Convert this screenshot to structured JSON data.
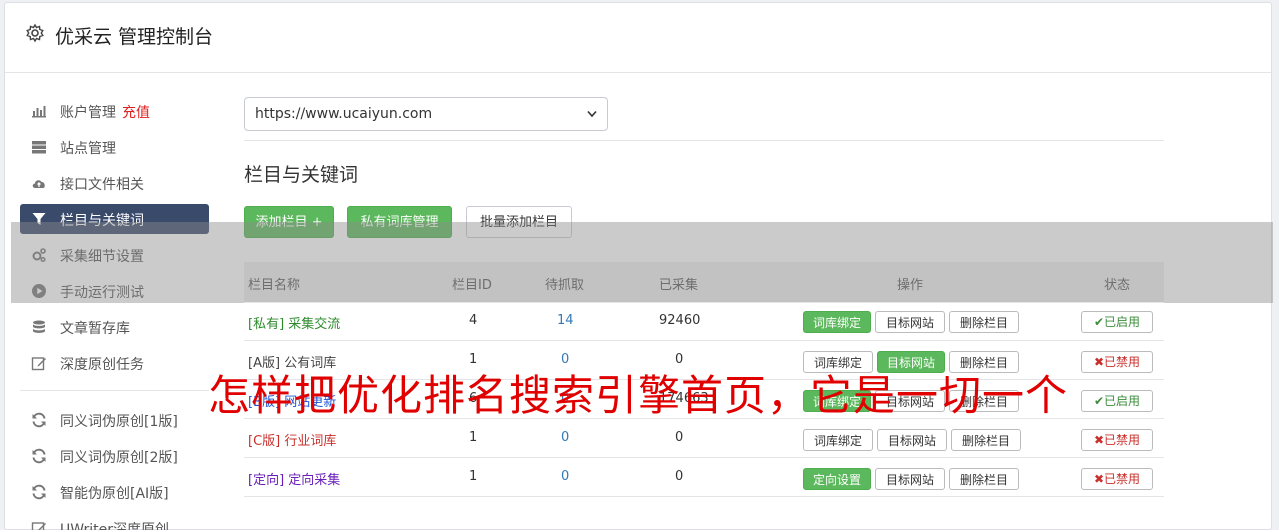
{
  "header": {
    "title": "优采云 管理控制台",
    "icon": "gear-icon"
  },
  "sidebar": {
    "items": [
      {
        "label": "账户管理",
        "extra": "充值",
        "icon": "bar-chart-icon",
        "active": false
      },
      {
        "label": "站点管理",
        "icon": "server-icon",
        "active": false
      },
      {
        "label": "接口文件相关",
        "icon": "cloud-upload-icon",
        "active": false
      },
      {
        "label": "栏目与关键词",
        "icon": "filter-icon",
        "active": true
      },
      {
        "label": "采集细节设置",
        "icon": "gears-icon",
        "active": false
      },
      {
        "label": "手动运行测试",
        "icon": "play-icon",
        "active": false
      },
      {
        "label": "文章暂存库",
        "icon": "database-icon",
        "active": false
      },
      {
        "label": "深度原创任务",
        "icon": "edit-icon",
        "active": false
      },
      {
        "label": "同义词伪原创[1版]",
        "icon": "refresh-icon",
        "active": false
      },
      {
        "label": "同义词伪原创[2版]",
        "icon": "refresh-icon",
        "active": false
      },
      {
        "label": "智能伪原创[AI版]",
        "icon": "refresh-icon",
        "active": false
      },
      {
        "label": "UWriter深度原创",
        "icon": "edit-icon",
        "active": false
      }
    ]
  },
  "site_select": {
    "value": "https://www.ucaiyun.com"
  },
  "section": {
    "title": "栏目与关键词"
  },
  "toolbar": {
    "add_label": "添加栏目 +",
    "private_label": "私有词库管理",
    "batch_label": "批量添加栏目"
  },
  "table": {
    "headers": [
      "栏目名称",
      "栏目ID",
      "待抓取",
      "已采集",
      "操作",
      "状态"
    ],
    "rows": [
      {
        "tag": "[私有]",
        "name": "采集交流",
        "id": "4",
        "pending": "14",
        "collected": "92460",
        "op1": "词库绑定",
        "op2": "目标网站",
        "op3": "删除栏目",
        "status": "已启用"
      },
      {
        "tag": "[A版]",
        "name": "公有词库",
        "id": "1",
        "pending": "0",
        "collected": "0",
        "op1": "词库绑定",
        "op2": "目标网站",
        "op3": "删除栏目",
        "status": "已禁用"
      },
      {
        "tag": "[B版]",
        "name": "网站更新",
        "id": "6",
        "pending": "0",
        "collected": "174663",
        "op1": "词库绑定",
        "op2": "目标网站",
        "op3": "删除栏目",
        "status": "已启用"
      },
      {
        "tag": "[C版]",
        "name": "行业词库",
        "id": "1",
        "pending": "0",
        "collected": "0",
        "op1": "词库绑定",
        "op2": "目标网站",
        "op3": "删除栏目",
        "status": "已禁用"
      },
      {
        "tag": "[定向]",
        "name": "定向采集",
        "id": "1",
        "pending": "0",
        "collected": "0",
        "op1": "定向设置",
        "op2": "目标网站",
        "op3": "删除栏目",
        "status": "已禁用"
      }
    ]
  },
  "watermark": {
    "text": "怎样把优化排名搜索引擎首页，它是一切一个"
  },
  "colors": {
    "sidebar_active": "#3a4a6b",
    "button_green": "#5cb85c",
    "watermark_red": "#e00000"
  }
}
